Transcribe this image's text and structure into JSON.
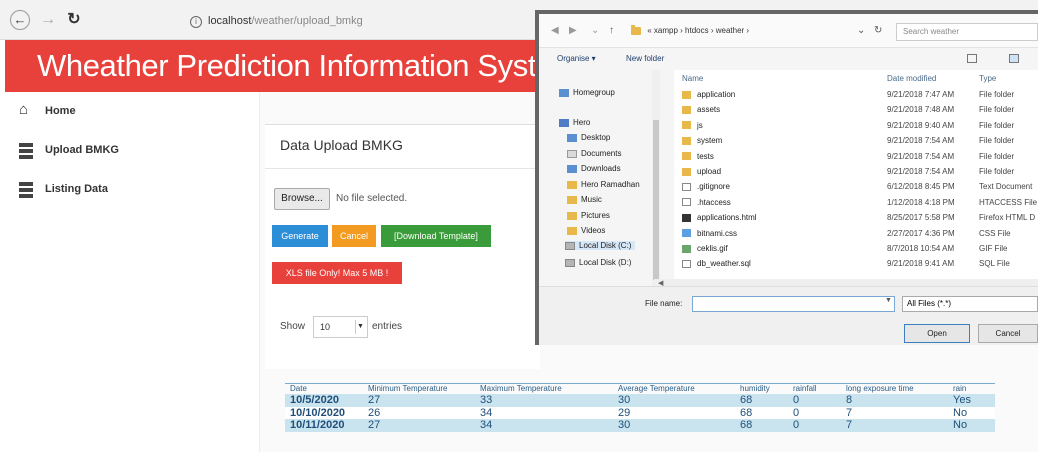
{
  "browser": {
    "address_host": "localhost",
    "address_path": "/weather/upload_bmkg"
  },
  "app": {
    "title": "Wheather Prediction Information System"
  },
  "sidebar": {
    "items": [
      {
        "label": "Home",
        "icon": "home-icon"
      },
      {
        "label": "Upload BMKG",
        "icon": "server-icon"
      },
      {
        "label": "Listing Data",
        "icon": "server-icon"
      }
    ]
  },
  "panel": {
    "title": "Data Upload BMKG",
    "browse_label": "Browse...",
    "file_status": "No file selected.",
    "generate_label": "Generate",
    "cancel_label": "Cancel",
    "template_label": "[Download Template]",
    "warning": "XLS file Only! Max 5 MB !"
  },
  "datatable": {
    "show_label": "Show",
    "page_size": "10",
    "entries_label": "entries",
    "columns": [
      "Date",
      "Minimum Temperature",
      "Maximum Temperature",
      "Average Temperature",
      "humidity",
      "rainfall",
      "long exposure time",
      "rain"
    ],
    "rows": [
      [
        "10/5/2020",
        "27",
        "33",
        "30",
        "68",
        "0",
        "8",
        "Yes"
      ],
      [
        "10/10/2020",
        "26",
        "34",
        "29",
        "68",
        "0",
        "7",
        "No"
      ],
      [
        "10/11/2020",
        "27",
        "34",
        "30",
        "68",
        "0",
        "7",
        "No"
      ]
    ]
  },
  "dialog": {
    "path": [
      "« xampp",
      "htdocs",
      "weather"
    ],
    "search_placeholder": "Search weather",
    "organise_label": "Organise ▾",
    "new_folder_label": "New folder",
    "nav": [
      {
        "label": "Homegroup",
        "icon": "mini-blue"
      },
      {
        "label": "Hero",
        "icon": "mini-pc"
      },
      {
        "label": "Desktop",
        "icon": "mini-blue"
      },
      {
        "label": "Documents",
        "icon": "mini-doc"
      },
      {
        "label": "Downloads",
        "icon": "mini-blue"
      },
      {
        "label": "Hero Ramadhan",
        "icon": "mini-folder"
      },
      {
        "label": "Music",
        "icon": "mini-folder"
      },
      {
        "label": "Pictures",
        "icon": "mini-folder"
      },
      {
        "label": "Videos",
        "icon": "mini-folder"
      },
      {
        "label": "Local Disk (C:)",
        "icon": "mini-drive"
      },
      {
        "label": "Local Disk (D:)",
        "icon": "mini-drive"
      }
    ],
    "columns": {
      "name": "Name",
      "date": "Date modified",
      "type": "Type"
    },
    "files": [
      {
        "name": "application",
        "date": "9/21/2018 7:47 AM",
        "type": "File folder",
        "icon": "mini-folder"
      },
      {
        "name": "assets",
        "date": "9/21/2018 7:48 AM",
        "type": "File folder",
        "icon": "mini-folder"
      },
      {
        "name": "js",
        "date": "9/21/2018 9:40 AM",
        "type": "File folder",
        "icon": "mini-folder"
      },
      {
        "name": "system",
        "date": "9/21/2018 7:54 AM",
        "type": "File folder",
        "icon": "mini-folder"
      },
      {
        "name": "tests",
        "date": "9/21/2018 7:54 AM",
        "type": "File folder",
        "icon": "mini-folder"
      },
      {
        "name": "upload",
        "date": "9/21/2018 7:54 AM",
        "type": "File folder",
        "icon": "mini-folder"
      },
      {
        "name": ".gitignore",
        "date": "6/12/2018 8:45 PM",
        "type": "Text Document",
        "icon": "mini-file"
      },
      {
        "name": ".htaccess",
        "date": "1/12/2018 4:18 PM",
        "type": "HTACCESS File",
        "icon": "mini-file"
      },
      {
        "name": "applications.html",
        "date": "8/25/2017 5:58 PM",
        "type": "Firefox HTML D",
        "icon": "mini-html"
      },
      {
        "name": "bitnami.css",
        "date": "2/27/2017 4:36 PM",
        "type": "CSS File",
        "icon": "mini-css"
      },
      {
        "name": "ceklis.gif",
        "date": "8/7/2018 10:54 AM",
        "type": "GIF File",
        "icon": "mini-gif"
      },
      {
        "name": "db_weather.sql",
        "date": "9/21/2018 9:41 AM",
        "type": "SQL File",
        "icon": "mini-file"
      }
    ],
    "filename_label": "File name:",
    "filename_value": "",
    "filter_value": "All Files (*.*)",
    "open_label": "Open",
    "cancel_label": "Cancel"
  }
}
